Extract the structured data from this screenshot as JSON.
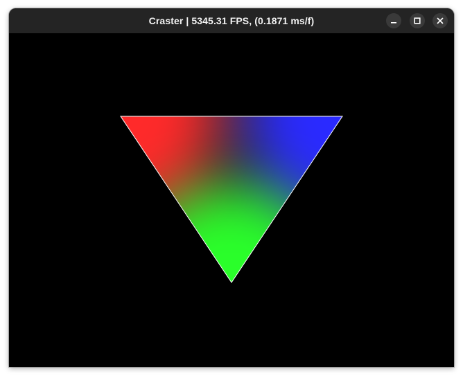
{
  "window": {
    "title": "Craster | 5345.31 FPS, (0.1871 ms/f)",
    "controls": {
      "minimize": "minimize-icon",
      "maximize": "maximize-icon",
      "close": "close-icon"
    }
  },
  "viewport": {
    "background": "#000000",
    "triangle": {
      "vertex_colors": {
        "top_left": "#ff0000",
        "top_right": "#0000ff",
        "bottom": "#00ff00"
      },
      "edge_color": "#ffffff"
    }
  }
}
